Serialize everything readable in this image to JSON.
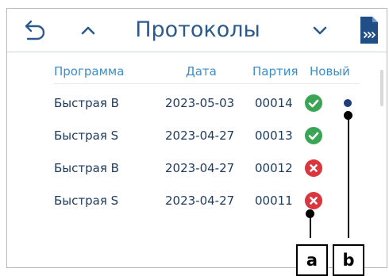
{
  "header": {
    "title": "Протоколы",
    "icons": [
      "undo-arrow-icon",
      "chevron-up-icon",
      "chevron-down-icon",
      "export-document-icon"
    ]
  },
  "table": {
    "columns": [
      "Программа",
      "Дата",
      "Партия",
      "Новый"
    ],
    "rows": [
      {
        "program": "Быстрая B",
        "date": "2023-05-03",
        "batch": "00014",
        "status": "success",
        "new": true
      },
      {
        "program": "Быстрая S",
        "date": "2023-04-27",
        "batch": "00013",
        "status": "success",
        "new": false
      },
      {
        "program": "Быстрая B",
        "date": "2023-04-27",
        "batch": "00012",
        "status": "error",
        "new": false
      },
      {
        "program": "Быстрая S",
        "date": "2023-04-27",
        "batch": "00011",
        "status": "error",
        "new": false
      }
    ]
  },
  "callouts": {
    "a": "a",
    "b": "b"
  },
  "colors": {
    "title": "#2b5b8e",
    "header_text": "#3b8ecb",
    "success": "#3aa655",
    "error": "#d9363e",
    "new_dot": "#1f3e7a"
  }
}
